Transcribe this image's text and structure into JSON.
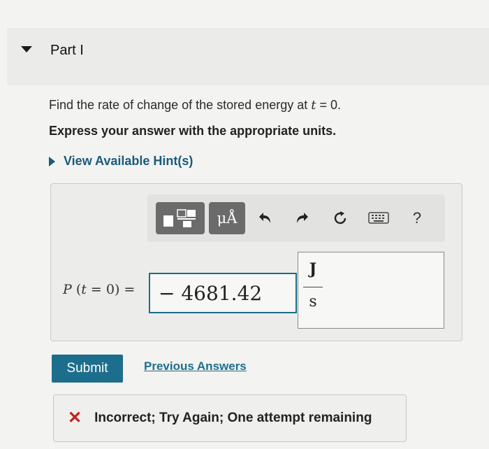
{
  "part": {
    "title": "Part I"
  },
  "question": {
    "text_before": "Find the rate of change of the stored energy at ",
    "var": "t",
    "text_after": " = 0.",
    "instruction": "Express your answer with the appropriate units.",
    "hint_label": "View Available Hint(s)"
  },
  "toolbar": {
    "units_label": "μÅ",
    "help_label": "?"
  },
  "answer": {
    "lhs_func": "P",
    "lhs_var": "t",
    "lhs_rest": " = 0) =",
    "value": "− 4681.42",
    "unit_numerator": "J",
    "unit_denominator": "s"
  },
  "actions": {
    "submit_label": "Submit",
    "previous_answers_label": "Previous Answers"
  },
  "feedback": {
    "message": "Incorrect; Try Again; One attempt remaining",
    "status_color": "#c81e1e"
  }
}
